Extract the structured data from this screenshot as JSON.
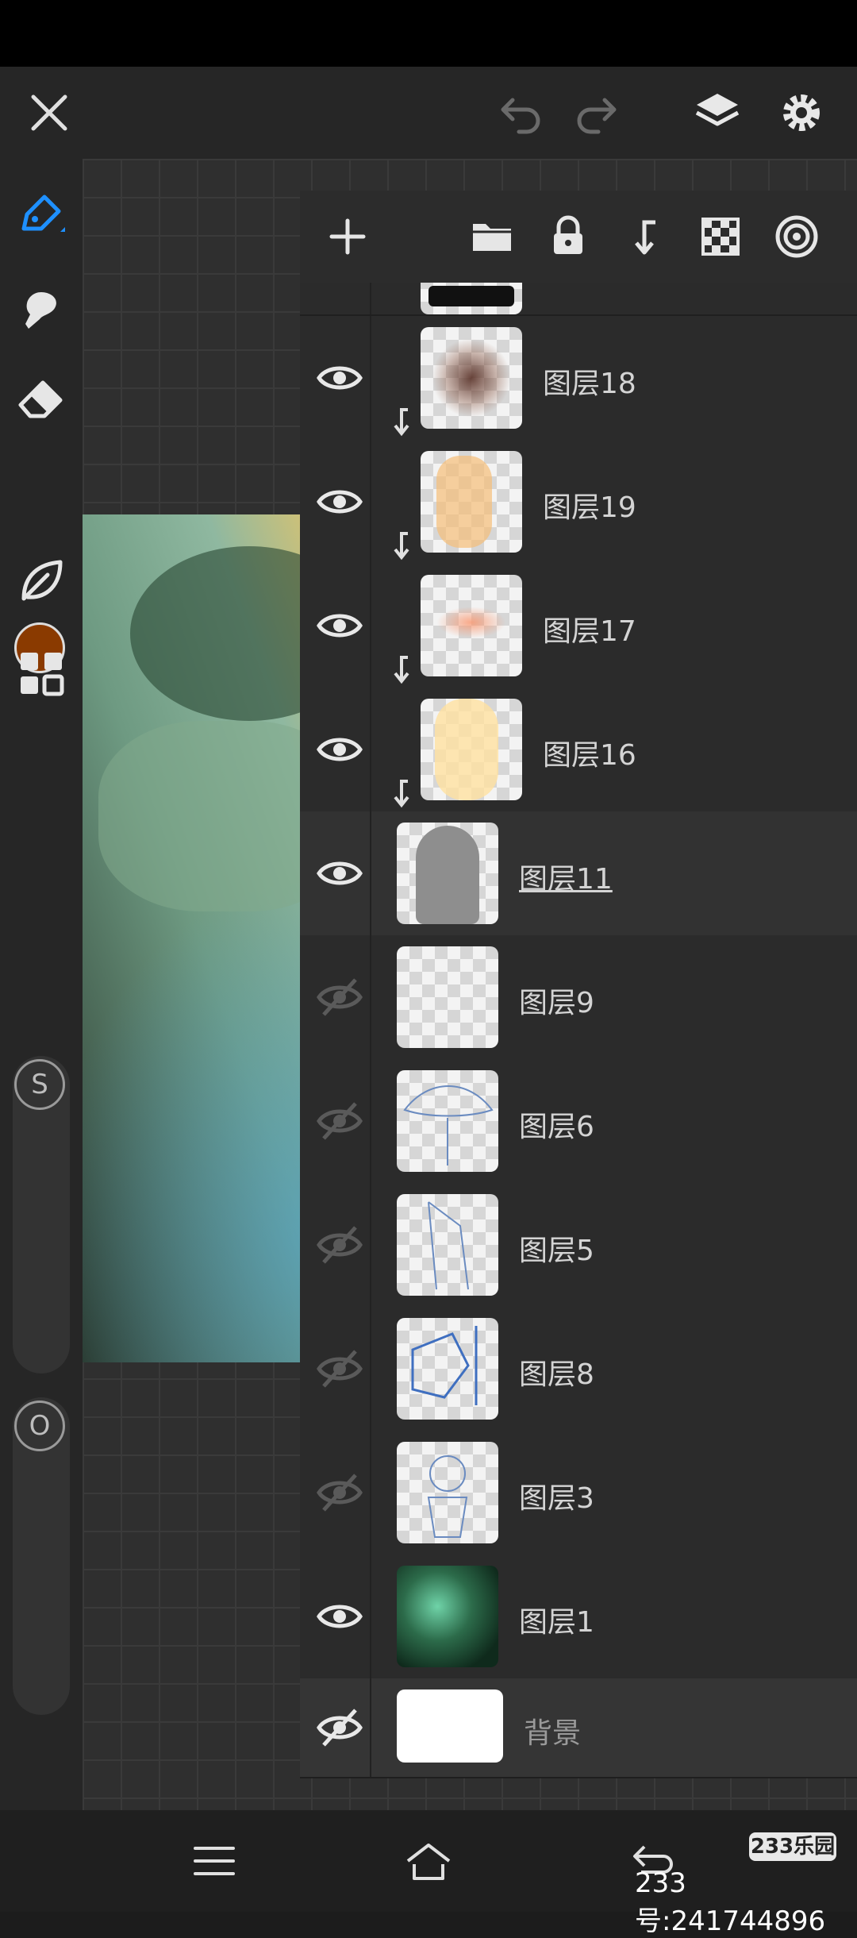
{
  "header": {
    "close_icon": "close-icon",
    "undo_icon": "undo-icon",
    "redo_icon": "redo-icon",
    "layers_icon": "layers-icon",
    "settings_icon": "gear-icon"
  },
  "tools": {
    "items": [
      "pen-icon",
      "smudge-icon",
      "eraser-icon",
      "color-swatch",
      "leaf-icon",
      "grid-icon"
    ],
    "current_color": "#8a3a00",
    "accent": "#1e90ff"
  },
  "sliders": {
    "size_label": "S",
    "opacity_label": "O"
  },
  "layer_panel": {
    "toolbar_icons": [
      "add-layer-icon",
      "folder-icon",
      "lock-icon",
      "clip-icon",
      "transparency-icon",
      "blend-icon"
    ],
    "layers": [
      {
        "name": "图层18",
        "visible": true,
        "clipped": true
      },
      {
        "name": "图层19",
        "visible": true,
        "clipped": true
      },
      {
        "name": "图层17",
        "visible": true,
        "clipped": true
      },
      {
        "name": "图层16",
        "visible": true,
        "clipped": true
      },
      {
        "name": "图层11",
        "visible": true,
        "clipped": false,
        "selected": true
      },
      {
        "name": "图层9",
        "visible": false,
        "clipped": false
      },
      {
        "name": "图层6",
        "visible": false,
        "clipped": false
      },
      {
        "name": "图层5",
        "visible": false,
        "clipped": false
      },
      {
        "name": "图层8",
        "visible": false,
        "clipped": false
      },
      {
        "name": "图层3",
        "visible": false,
        "clipped": false
      },
      {
        "name": "图层1",
        "visible": true,
        "clipped": false
      },
      {
        "name": "背景",
        "visible": false,
        "clipped": false
      }
    ]
  },
  "navbar": {
    "menu_icon": "menu-icon",
    "home_icon": "home-icon",
    "back_icon": "back-icon"
  },
  "watermark": {
    "badge": "233乐园",
    "text": "233号:241744896"
  }
}
